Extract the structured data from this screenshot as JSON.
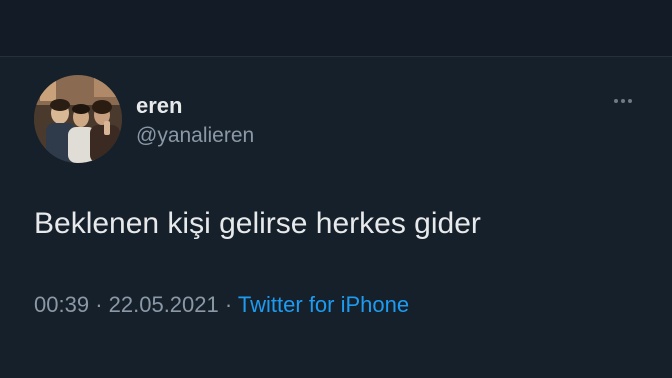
{
  "tweet": {
    "author": {
      "display_name": "eren",
      "handle": "@yanalieren"
    },
    "text": "Beklenen kişi gelirse herkes gider",
    "time": "00:39",
    "date": "22.05.2021",
    "separator": "·",
    "source": "Twitter for iPhone",
    "more_icon": "more-horizontal-icon"
  },
  "colors": {
    "background": "#15202b",
    "primary_text": "#e7e9ea",
    "secondary_text": "#8b98a5",
    "link": "#1d9bf0"
  }
}
